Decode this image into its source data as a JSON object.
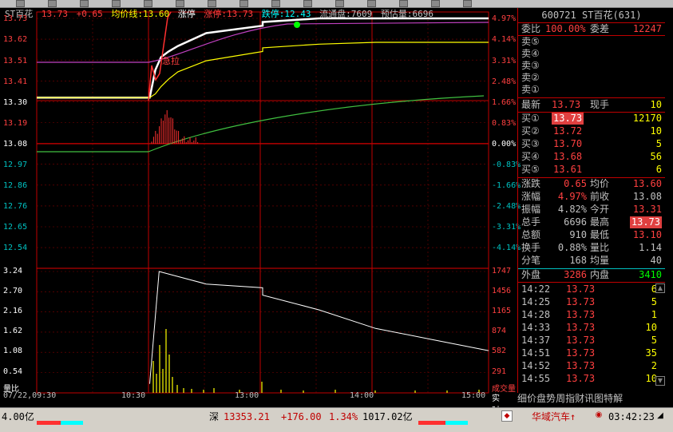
{
  "header": {
    "name": "ST百花",
    "price": "13.73",
    "change": "+0.65",
    "avg_label": "均价线:",
    "avg_value": "13.60",
    "limit_up_tag": "涨停",
    "limit_up_label": "涨停:",
    "limit_up_value": "13.73",
    "limit_down_label": "跌停:",
    "limit_down_value": "12.43",
    "float_label": "流通盘:",
    "float_value": "7609",
    "est_label": "预估量:",
    "est_value": "6696"
  },
  "price_axis_left": [
    "13.73",
    "13.62",
    "13.51",
    "13.41",
    "13.30",
    "13.19",
    "13.08",
    "12.97",
    "12.86",
    "12.76",
    "12.65",
    "12.54"
  ],
  "price_axis_right": [
    "4.97%",
    "4.14%",
    "3.31%",
    "2.48%",
    "1.66%",
    "0.83%",
    "0.00%",
    "-0.83%",
    "-1.66%",
    "-2.48%",
    "-3.31%",
    "-4.14%"
  ],
  "vol_axis_left": [
    "3.24",
    "2.70",
    "2.16",
    "1.62",
    "1.08",
    "0.54"
  ],
  "vol_axis_right": [
    "1747",
    "1456",
    "1165",
    "874",
    "582",
    "291"
  ],
  "vol_axis_left_label": "量比",
  "vol_axis_right_label": "成交量",
  "annotation": "急拉",
  "x_labels": [
    "07/22,09:30",
    "10:30",
    "13:00",
    "14:00",
    "15:00"
  ],
  "realtime_label": "实时",
  "chart_data": {
    "type": "line",
    "title": "",
    "xlabel": "",
    "ylabel": "",
    "x": [
      "09:30",
      "10:00",
      "10:30",
      "10:33",
      "10:36",
      "10:40",
      "10:45",
      "11:00",
      "11:30",
      "13:00",
      "13:30",
      "14:00",
      "14:30",
      "15:00"
    ],
    "ylim": [
      12.43,
      13.73
    ],
    "series": [
      {
        "name": "price",
        "values": [
          13.3,
          13.3,
          13.3,
          13.45,
          13.52,
          13.55,
          13.58,
          13.65,
          13.69,
          13.71,
          13.73,
          13.73,
          13.73,
          13.73
        ],
        "color": "#ffffff"
      },
      {
        "name": "均价线",
        "values": [
          13.3,
          13.3,
          13.3,
          13.32,
          13.36,
          13.4,
          13.44,
          13.5,
          13.55,
          13.57,
          13.59,
          13.6,
          13.6,
          13.6
        ],
        "color": "#ffff00"
      }
    ],
    "volume_ratio": {
      "ylim": [
        0,
        3.24
      ],
      "x": [
        "10:30",
        "10:35",
        "11:00",
        "11:30",
        "13:00",
        "13:30",
        "14:00",
        "14:30",
        "15:00"
      ],
      "values": [
        0.2,
        3.24,
        2.9,
        2.8,
        2.6,
        2.2,
        1.7,
        1.4,
        1.1
      ]
    }
  },
  "right_panel": {
    "stock_code": "600721",
    "stock_name": "ST百花",
    "stock_index": "(631)",
    "weibi_label": "委比",
    "weibi_value": "100.00%",
    "weicha_label": "委差",
    "weicha_value": "12247",
    "sell": [
      {
        "label": "卖⑤",
        "price": "",
        "vol": ""
      },
      {
        "label": "卖④",
        "price": "",
        "vol": ""
      },
      {
        "label": "卖③",
        "price": "",
        "vol": ""
      },
      {
        "label": "卖②",
        "price": "",
        "vol": ""
      },
      {
        "label": "卖①",
        "price": "",
        "vol": ""
      }
    ],
    "latest_label": "最新",
    "latest_value": "13.73",
    "xianshou_label": "现手",
    "xianshou_value": "10",
    "buy": [
      {
        "label": "买①",
        "price": "13.73",
        "vol": "12170"
      },
      {
        "label": "买②",
        "price": "13.72",
        "vol": "10"
      },
      {
        "label": "买③",
        "price": "13.70",
        "vol": "5"
      },
      {
        "label": "买④",
        "price": "13.68",
        "vol": "56"
      },
      {
        "label": "买⑤",
        "price": "13.61",
        "vol": "6"
      }
    ],
    "stats": [
      {
        "l1": "涨跌",
        "v1": "0.65",
        "l2": "均价",
        "v2": "13.60"
      },
      {
        "l1": "涨幅",
        "v1": "4.97%",
        "l2": "前收",
        "v2": "13.08"
      },
      {
        "l1": "振幅",
        "v1": "4.82%",
        "l2": "今开",
        "v2": "13.31"
      },
      {
        "l1": "总手",
        "v1": "6696",
        "l2": "最高",
        "v2": "13.73"
      },
      {
        "l1": "总额",
        "v1": "910",
        "l2": "最低",
        "v2": "13.10"
      },
      {
        "l1": "换手",
        "v1": "0.88%",
        "l2": "量比",
        "v2": "1.14"
      },
      {
        "l1": "分笔",
        "v1": "168",
        "l2": "均量",
        "v2": "40"
      }
    ],
    "waipan_label": "外盘",
    "waipan_value": "3286",
    "neipan_label": "内盘",
    "neipan_value": "3410",
    "ticks": [
      {
        "time": "14:22",
        "price": "13.73",
        "vol": "6"
      },
      {
        "time": "14:25",
        "price": "13.73",
        "vol": "5"
      },
      {
        "time": "14:28",
        "price": "13.73",
        "vol": "1"
      },
      {
        "time": "14:33",
        "price": "13.73",
        "vol": "10"
      },
      {
        "time": "14:37",
        "price": "13.73",
        "vol": "5"
      },
      {
        "time": "14:51",
        "price": "13.73",
        "vol": "35"
      },
      {
        "time": "14:52",
        "price": "13.73",
        "vol": "2"
      },
      {
        "time": "14:55",
        "price": "13.73",
        "vol": "10"
      }
    ],
    "tabs": [
      "细",
      "价",
      "盘",
      "势",
      "周",
      "指",
      "财",
      "讯",
      "图",
      "特",
      "解"
    ]
  },
  "statusbar": {
    "left_amount": "4.00亿",
    "market": "深",
    "index_value": "13353.21",
    "index_change": "+176.00",
    "index_pct": "1.34%",
    "index_amount": "1017.02亿",
    "news": "华域汽车↑",
    "clock": "03:42:23"
  }
}
